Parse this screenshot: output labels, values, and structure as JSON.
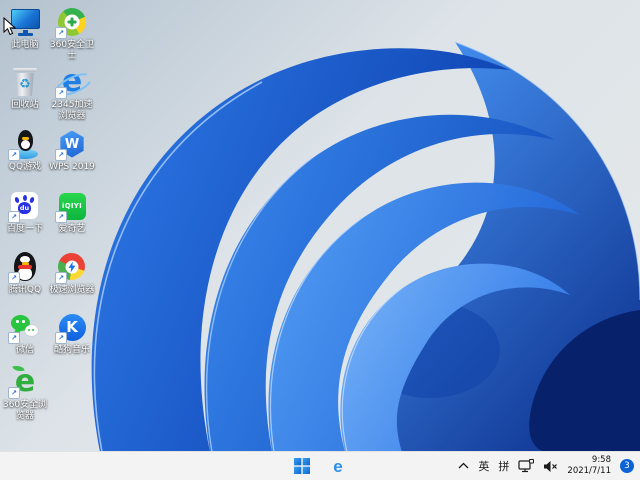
{
  "desktop": {
    "icons": [
      {
        "label": "此电脑"
      },
      {
        "label": "360安全卫士"
      },
      {
        "label": "回收站"
      },
      {
        "label": "2345加速浏览器"
      },
      {
        "label": "QQ游戏"
      },
      {
        "label": "WPS 2019"
      },
      {
        "label": "百度一下"
      },
      {
        "label": "爱奇艺"
      },
      {
        "label": "腾讯QQ"
      },
      {
        "label": "极速浏览器"
      },
      {
        "label": "微信"
      },
      {
        "label": "酷狗音乐"
      },
      {
        "label": "360安全浏览器"
      }
    ]
  },
  "icon_glyphs": {
    "shortcut_arrow": "↗",
    "recycle": "♻",
    "e_letter": "e",
    "wps_letter": "W",
    "baidu_du": "du",
    "iqiyi_text": "iQIYI",
    "kugou_letter": "K",
    "taskbar_e": "e"
  },
  "taskbar": {
    "tray": {
      "ime_english": "英",
      "ime_pinyin": "拼"
    },
    "clock": {
      "time": "9:58",
      "date": "2021/7/11"
    },
    "notification_count": "3"
  },
  "colors": {
    "bloom_blue": "#2f7ce9",
    "bloom_dark": "#0a2f85",
    "bloom_highlight": "#9fc8fa",
    "wallpaper_bg": "#d9e0e6",
    "taskbar_bg": "#f3f3f3",
    "badge_blue": "#0b63d6",
    "accent_blue": "#1f7fe6"
  }
}
